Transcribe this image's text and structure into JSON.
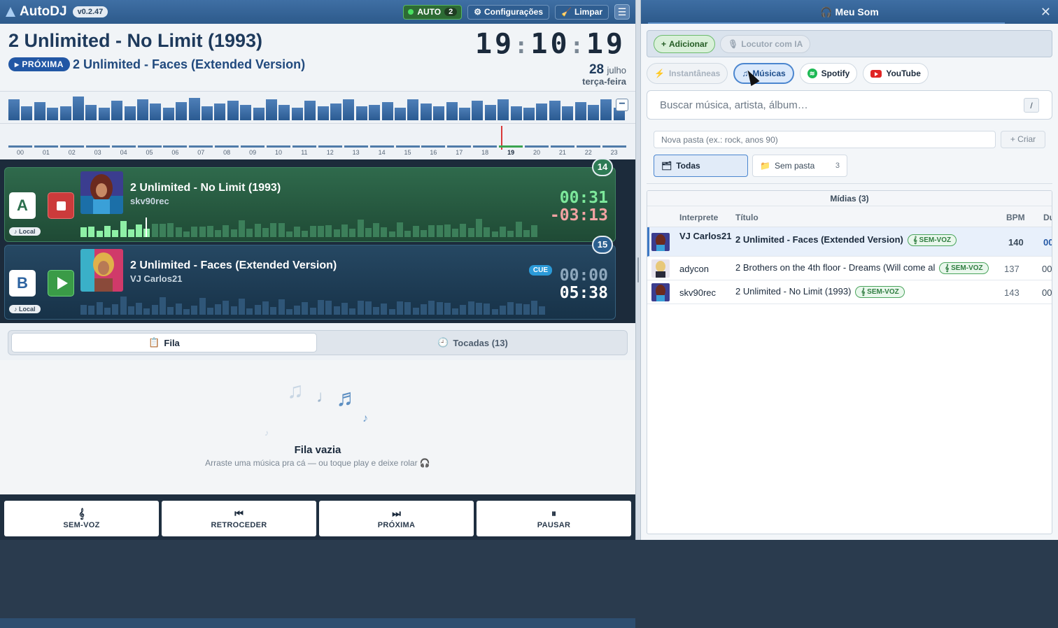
{
  "app": {
    "name": "AutoDJ",
    "version": "v0.2.47"
  },
  "topbar": {
    "auto_label": "AUTO",
    "auto_count": "2",
    "settings_label": "Configurações",
    "clear_label": "Limpar",
    "menu_icon": "hamburger-icon"
  },
  "now_playing": {
    "title": "2 Unlimited - No Limit (1993)",
    "next_badge": "PRÓXIMA",
    "next_title": "2 Unlimited - Faces (Extended Version)"
  },
  "clock": {
    "hh": "19",
    "mm": "10",
    "ss": "19",
    "day": "28",
    "month": "julho",
    "weekday": "terça-feira"
  },
  "hour_bars": [
    30,
    20,
    26,
    18,
    20,
    34,
    22,
    18,
    28,
    20,
    30,
    24,
    18,
    26,
    32,
    20,
    24,
    28,
    22,
    18,
    30,
    22,
    18,
    28,
    20,
    24,
    30,
    20,
    22,
    26,
    18,
    30,
    24,
    20,
    26,
    18,
    28,
    22,
    30,
    20,
    18,
    24,
    28,
    20,
    26,
    22,
    30,
    18
  ],
  "timeline": {
    "hours": [
      "00",
      "01",
      "02",
      "03",
      "04",
      "05",
      "06",
      "07",
      "08",
      "09",
      "10",
      "11",
      "12",
      "13",
      "14",
      "15",
      "16",
      "17",
      "18",
      "19",
      "20",
      "21",
      "22",
      "23"
    ],
    "current": "19"
  },
  "deck_a": {
    "letter": "A",
    "number": "14",
    "title": "2 Unlimited - No Limit (1993)",
    "artist": "skv90rec",
    "elapsed": "00:31",
    "remaining": "-03:13",
    "source": "Local",
    "progress": 0.14,
    "color": "#2f6a4c"
  },
  "deck_b": {
    "letter": "B",
    "number": "15",
    "title": "2 Unlimited - Faces (Extended Version)",
    "artist": "VJ Carlos21",
    "elapsed": "00:00",
    "duration": "05:38",
    "cue": "CUE",
    "source": "Local",
    "color": "#264863"
  },
  "queue": {
    "tab_queue": "Fila",
    "tab_played": "Tocadas (13)",
    "empty_title": "Fila vazia",
    "empty_text": "Arraste uma música pra cá — ou toque play e deixe rolar 🎧"
  },
  "controls": [
    {
      "icon": "𝄞",
      "label": "SEM-VOZ"
    },
    {
      "icon": "⏮",
      "label": "RETROCEDER"
    },
    {
      "icon": "⏭",
      "label": "PRÓXIMA"
    },
    {
      "icon": "⏸",
      "label": "PAUSAR"
    }
  ],
  "panel": {
    "title": "Meu Som",
    "add_label": "Adicionar",
    "ia_label": "Locutor com IA",
    "sources": {
      "instant": "Instantâneas",
      "music": "Músicas",
      "spotify": "Spotify",
      "youtube": "YouTube"
    },
    "search_placeholder": "Buscar música, artista, álbum…",
    "search_shortcut": "/",
    "folder_placeholder": "Nova pasta (ex.: rock, anos 90)",
    "create_label": "+ Criar",
    "folder_all": "Todas",
    "folder_none": "Sem pasta",
    "folder_none_count": "3",
    "media_caption": "Mídias (3)",
    "columns": {
      "artist": "Interprete",
      "title": "Título",
      "bpm": "BPM",
      "dur": "Du"
    },
    "badge": "SEM-VOZ",
    "rows": [
      {
        "artist": "VJ Carlos21",
        "title": "2 Unlimited - Faces (Extended Version)",
        "bpm": "140",
        "dur": "00:"
      },
      {
        "artist": "adycon",
        "title": "2 Brothers on the 4th floor - Dreams (Will come al",
        "bpm": "137",
        "dur": "00"
      },
      {
        "artist": "skv90rec",
        "title": "2 Unlimited - No Limit (1993)",
        "bpm": "143",
        "dur": "00"
      }
    ]
  }
}
